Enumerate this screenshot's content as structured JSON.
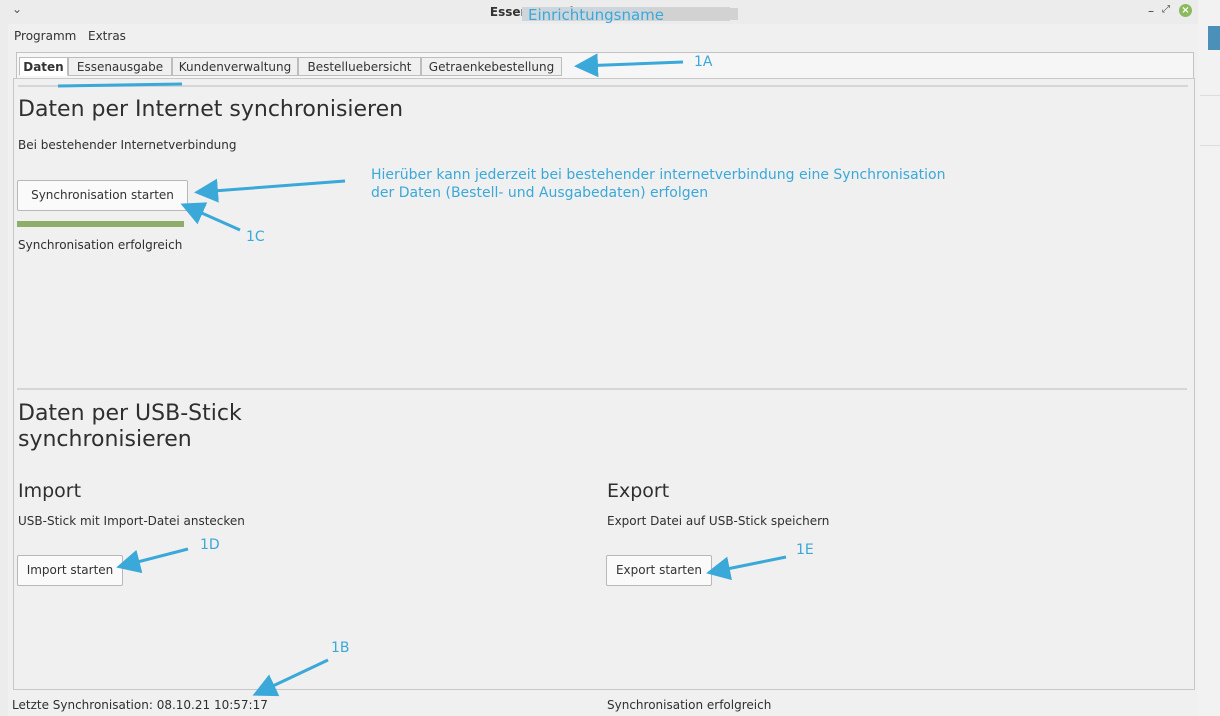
{
  "window": {
    "title": "Essenausgabe - I",
    "menu_glyph": "⌄",
    "minimize": "–",
    "maximize": "⤢",
    "close": "×"
  },
  "annotations_overlay": {
    "name_label": "Einrichtungsname",
    "tabs_callout": "1A",
    "status_callout": "1B",
    "sync_callout": "1C",
    "sync_description": [
      "Hierüber kann jederzeit bei bestehender internetverbindung eine Synchronisation",
      "der Daten (Bestell- und Ausgabedaten) erfolgen"
    ],
    "import_callout": "1D",
    "export_callout": "1E"
  },
  "menubar": {
    "items": [
      "Programm",
      "Extras"
    ]
  },
  "tabs": [
    {
      "label": "Daten",
      "active": true
    },
    {
      "label": "Essenausgabe",
      "active": false
    },
    {
      "label": "Kundenverwaltung",
      "active": false
    },
    {
      "label": "Bestelluebersicht",
      "active": false
    },
    {
      "label": "Getraenkebestellung",
      "active": false
    }
  ],
  "internet_sync": {
    "heading": "Daten per Internet synchronisieren",
    "subtitle": "Bei bestehender Internetverbindung",
    "button_label": "Synchronisation starten",
    "progress": 1.0,
    "status": "Synchronisation erfolgreich"
  },
  "usb_sync": {
    "heading_line1": "Daten per USB-Stick",
    "heading_line2": "synchronisieren",
    "import": {
      "heading": "Import",
      "subtitle": "USB-Stick mit Import-Datei anstecken",
      "button_label": "Import starten"
    },
    "export": {
      "heading": "Export",
      "subtitle": "Export Datei auf USB-Stick speichern",
      "button_label": "Export starten"
    }
  },
  "statusbar": {
    "last_sync": "Letzte Synchronisation: 08.10.21 10:57:17",
    "status": "Synchronisation erfolgreich"
  },
  "colors": {
    "annotation": "#3aa8d8",
    "progress_fill": "#8fae6a",
    "close_button": "#8bbb5e"
  }
}
